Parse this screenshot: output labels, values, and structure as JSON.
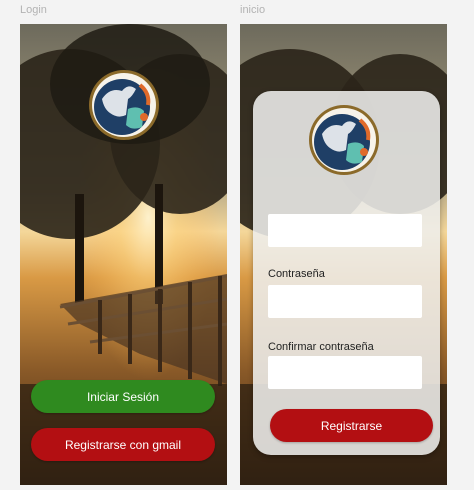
{
  "frames": {
    "login": {
      "label": "Login",
      "login_button": "Iniciar Sesión",
      "gmail_button": "Registrarse con gmail"
    },
    "inicio": {
      "label": "inicio",
      "password_label": "Contraseña",
      "confirm_password_label": "Confirmar contraseña",
      "register_button": "Registrarse"
    }
  },
  "colors": {
    "login_button": "#2f8a1f",
    "gmail_button": "#b30f12",
    "register_button": "#b30f12",
    "logo_ring": "#8b6a2a",
    "logo_blue": "#1f3f66"
  },
  "icons": [
    "farm-logo-icon"
  ]
}
